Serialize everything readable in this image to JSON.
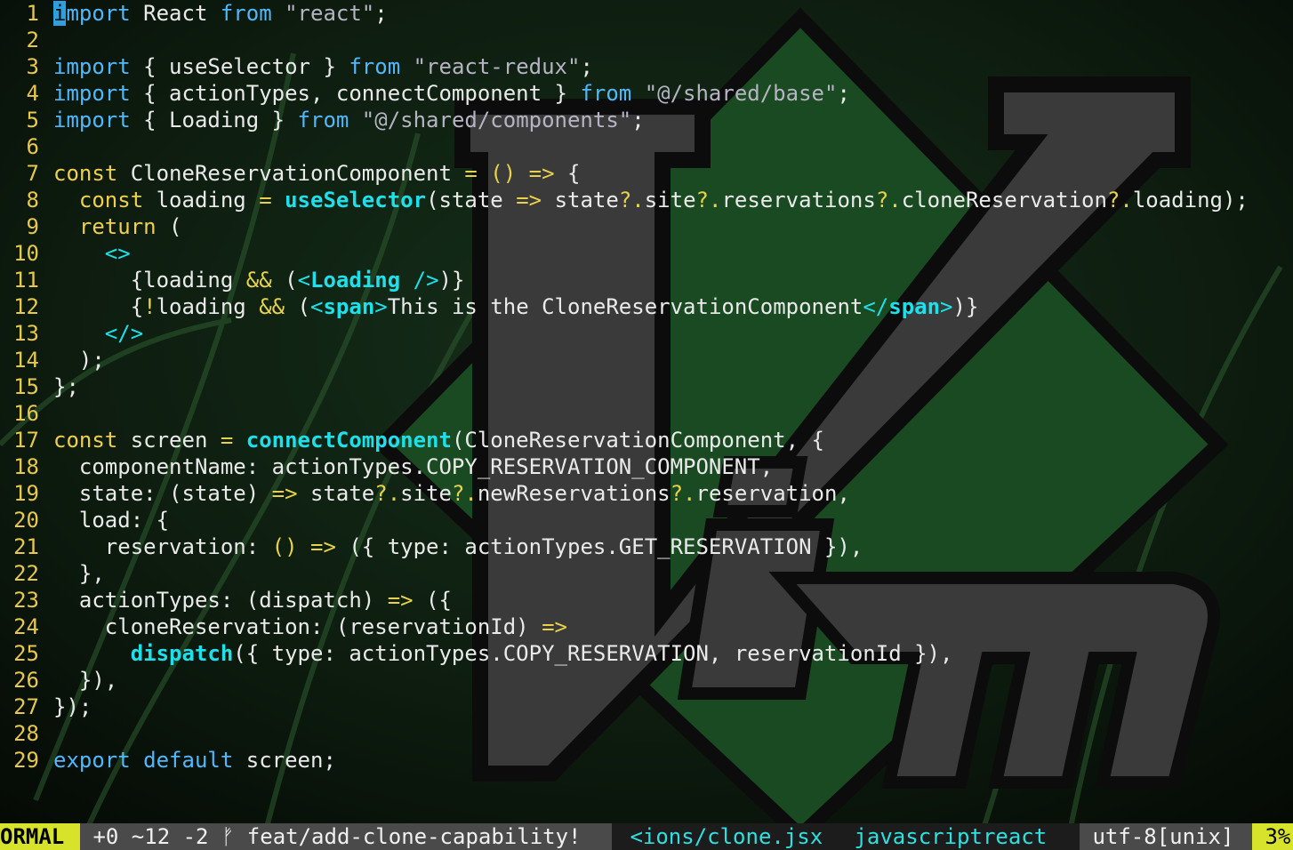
{
  "editor": {
    "lines": [
      [
        [
          "cursor",
          "i"
        ],
        [
          "keyword",
          "mport"
        ],
        [
          "default",
          " React "
        ],
        [
          "keyword",
          "from"
        ],
        [
          "default",
          " "
        ],
        [
          "string",
          "\"react\""
        ],
        [
          "default",
          ";"
        ]
      ],
      [],
      [
        [
          "keyword",
          "import"
        ],
        [
          "default",
          " { useSelector } "
        ],
        [
          "keyword",
          "from"
        ],
        [
          "default",
          " "
        ],
        [
          "string",
          "\"react-redux\""
        ],
        [
          "default",
          ";"
        ]
      ],
      [
        [
          "keyword",
          "import"
        ],
        [
          "default",
          " { actionTypes, connectComponent } "
        ],
        [
          "keyword",
          "from"
        ],
        [
          "default",
          " "
        ],
        [
          "string",
          "\"@/shared/base\""
        ],
        [
          "default",
          ";"
        ]
      ],
      [
        [
          "keyword",
          "import"
        ],
        [
          "default",
          " { Loading } "
        ],
        [
          "keyword",
          "from"
        ],
        [
          "default",
          " "
        ],
        [
          "string",
          "\"@/shared/components\""
        ],
        [
          "default",
          ";"
        ]
      ],
      [],
      [
        [
          "storage",
          "const"
        ],
        [
          "default",
          " CloneReservationComponent "
        ],
        [
          "operator",
          "="
        ],
        [
          "default",
          " "
        ],
        [
          "operator",
          "()"
        ],
        [
          "default",
          " "
        ],
        [
          "operator",
          "=>"
        ],
        [
          "default",
          " {"
        ]
      ],
      [
        [
          "default",
          "  "
        ],
        [
          "storage",
          "const"
        ],
        [
          "default",
          " loading "
        ],
        [
          "operator",
          "="
        ],
        [
          "default",
          " "
        ],
        [
          "function",
          "useSelector"
        ],
        [
          "default",
          "(state "
        ],
        [
          "operator",
          "=>"
        ],
        [
          "default",
          " state"
        ],
        [
          "operator",
          "?."
        ],
        [
          "default",
          "site"
        ],
        [
          "operator",
          "?."
        ],
        [
          "default",
          "reservations"
        ],
        [
          "operator",
          "?."
        ],
        [
          "default",
          "cloneReservation"
        ],
        [
          "operator",
          "?."
        ],
        [
          "default",
          "loading);"
        ]
      ],
      [
        [
          "default",
          "  "
        ],
        [
          "storage",
          "return"
        ],
        [
          "default",
          " ("
        ]
      ],
      [
        [
          "default",
          "    "
        ],
        [
          "tagpunct",
          "<>"
        ]
      ],
      [
        [
          "default",
          "      {loading "
        ],
        [
          "operator",
          "&&"
        ],
        [
          "default",
          " ("
        ],
        [
          "tagpunct",
          "<"
        ],
        [
          "tag",
          "Loading"
        ],
        [
          "default",
          " "
        ],
        [
          "tagpunct",
          "/>"
        ],
        [
          "default",
          ")}"
        ]
      ],
      [
        [
          "default",
          "      {"
        ],
        [
          "operator",
          "!"
        ],
        [
          "default",
          "loading "
        ],
        [
          "operator",
          "&&"
        ],
        [
          "default",
          " ("
        ],
        [
          "tagpunct",
          "<"
        ],
        [
          "tag",
          "span"
        ],
        [
          "tagpunct",
          ">"
        ],
        [
          "default",
          "This is the CloneReservationComponent"
        ],
        [
          "tagpunct",
          "</"
        ],
        [
          "tag",
          "span"
        ],
        [
          "tagpunct",
          ">"
        ],
        [
          "default",
          ")}"
        ]
      ],
      [
        [
          "default",
          "    "
        ],
        [
          "tagpunct",
          "</>"
        ]
      ],
      [
        [
          "default",
          "  );"
        ]
      ],
      [
        [
          "default",
          "};"
        ]
      ],
      [],
      [
        [
          "storage",
          "const"
        ],
        [
          "default",
          " screen "
        ],
        [
          "operator",
          "="
        ],
        [
          "default",
          " "
        ],
        [
          "function",
          "connectComponent"
        ],
        [
          "default",
          "(CloneReservationComponent, {"
        ]
      ],
      [
        [
          "default",
          "  componentName: actionTypes.COPY_RESERVATION_COMPONENT,"
        ]
      ],
      [
        [
          "default",
          "  state: (state) "
        ],
        [
          "operator",
          "=>"
        ],
        [
          "default",
          " state"
        ],
        [
          "operator",
          "?."
        ],
        [
          "default",
          "site"
        ],
        [
          "operator",
          "?."
        ],
        [
          "default",
          "newReservations"
        ],
        [
          "operator",
          "?."
        ],
        [
          "default",
          "reservation,"
        ]
      ],
      [
        [
          "default",
          "  load: {"
        ]
      ],
      [
        [
          "default",
          "    reservation: "
        ],
        [
          "operator",
          "()"
        ],
        [
          "default",
          " "
        ],
        [
          "operator",
          "=>"
        ],
        [
          "default",
          " ({ type: actionTypes.GET_RESERVATION }),"
        ]
      ],
      [
        [
          "default",
          "  },"
        ]
      ],
      [
        [
          "default",
          "  actionTypes: (dispatch) "
        ],
        [
          "operator",
          "=>"
        ],
        [
          "default",
          " ({"
        ]
      ],
      [
        [
          "default",
          "    cloneReservation: (reservationId) "
        ],
        [
          "operator",
          "=>"
        ]
      ],
      [
        [
          "default",
          "      "
        ],
        [
          "function",
          "dispatch"
        ],
        [
          "default",
          "({ type: actionTypes.COPY_RESERVATION, reservationId }),"
        ]
      ],
      [
        [
          "default",
          "  }),"
        ]
      ],
      [
        [
          "default",
          "});"
        ]
      ],
      [],
      [
        [
          "keyword",
          "export"
        ],
        [
          "default",
          " "
        ],
        [
          "keyword",
          "default"
        ],
        [
          "default",
          " screen;"
        ]
      ]
    ],
    "line_numbers": [
      "1",
      "2",
      "3",
      "4",
      "5",
      "6",
      "7",
      "8",
      "9",
      "10",
      "11",
      "12",
      "13",
      "14",
      "15",
      "16",
      "17",
      "18",
      "19",
      "20",
      "21",
      "22",
      "23",
      "24",
      "25",
      "26",
      "27",
      "28",
      "29"
    ]
  },
  "statusline": {
    "mode": "ORMAL",
    "git_diff": " +0 ~12 -2 ",
    "branch_icon": "ᚠ",
    "branch": " feat/add-clone-capability! ",
    "file": " <ions/clone.jsx",
    "filetype": " javascriptreact ",
    "encoding": " utf-8[unix] ",
    "percent": " 3%"
  },
  "colors": {
    "mode_bg": "#d7e22b",
    "git_bg": "#4a4a4a",
    "file_fg": "#2ee0e0",
    "line_number": "#e6c84a",
    "keyword": "#4fb8ff",
    "function": "#1ee0ea",
    "vim_logo_green": "#1a4a22",
    "vim_logo_gray": "#3a3a3a"
  },
  "background": {
    "logo": "vim-logo-icon"
  }
}
